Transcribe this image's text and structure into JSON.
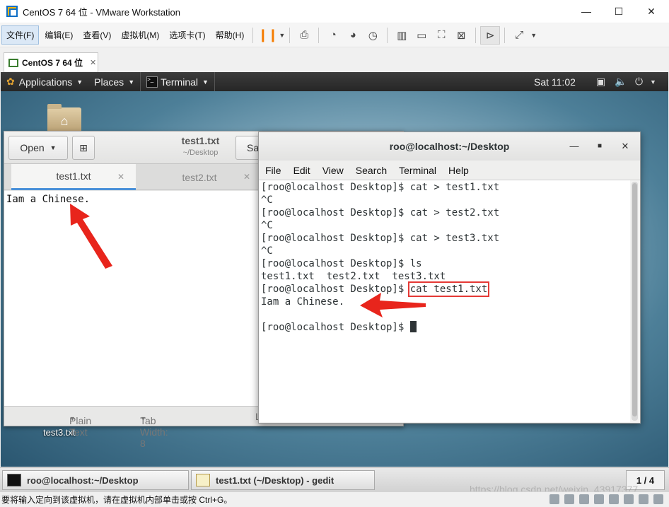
{
  "vmware": {
    "title": "CentOS 7 64 位 - VMware Workstation",
    "window_controls": {
      "minimize": "—",
      "maximize": "☐",
      "close": "✕"
    },
    "menu": [
      "文件(F)",
      "编辑(E)",
      "查看(V)",
      "虚拟机(M)",
      "选项卡(T)",
      "帮助(H)"
    ],
    "tab": {
      "label": "CentOS 7 64 位",
      "close": "✕"
    },
    "status_text": "要将输入定向到该虚拟机，请在虚拟机内部单击或按 Ctrl+G。"
  },
  "gnome_panel": {
    "applications": "Applications",
    "places": "Places",
    "terminal": "Terminal",
    "clock": "Sat 11:02"
  },
  "desktop": {
    "file_icon_label": "test3.txt"
  },
  "gedit": {
    "open_label": "Open",
    "save_label": "Sa",
    "title": "test1.txt",
    "subtitle": "~/Desktop",
    "tabs": [
      {
        "label": "test1.txt",
        "close": "✕"
      },
      {
        "label": "test2.txt",
        "close": "✕"
      }
    ],
    "content": "Iam a Chinese.",
    "status": {
      "syntax": "Plain Text",
      "tab_width": "Tab Width: 8",
      "line": "L"
    }
  },
  "terminal": {
    "title": "roo@localhost:~/Desktop",
    "menu": [
      "File",
      "Edit",
      "View",
      "Search",
      "Terminal",
      "Help"
    ],
    "lines": [
      "[roo@localhost Desktop]$ cat > test1.txt",
      "^C",
      "[roo@localhost Desktop]$ cat > test2.txt",
      "^C",
      "[roo@localhost Desktop]$ cat > test3.txt",
      "^C",
      "[roo@localhost Desktop]$ ls",
      "test1.txt  test2.txt  test3.txt"
    ],
    "highlight_prompt": "[roo@localhost Desktop]$ ",
    "highlight_command": "cat test1.txt",
    "output": "Iam a Chinese.",
    "final_prompt": "[roo@localhost Desktop]$ "
  },
  "taskbar": {
    "items": [
      "roo@localhost:~/Desktop",
      "test1.txt (~/Desktop) - gedit"
    ],
    "workspace": "1 / 4"
  },
  "watermark": "https://blog.csdn.net/weixin_43917377"
}
